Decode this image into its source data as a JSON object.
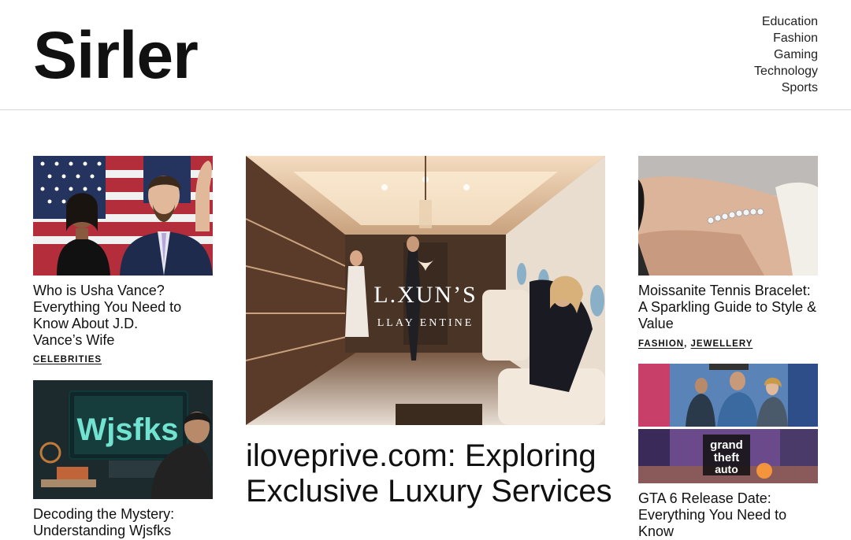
{
  "site": {
    "logo": "Sirler"
  },
  "nav": [
    "Education",
    "Fashion",
    "Gaming",
    "Technology",
    "Sports"
  ],
  "left_col": [
    {
      "title": "Who is Usha Vance? Everything You Need to Know About J.D. Vance’s Wife",
      "category": "CELEBRITIES"
    },
    {
      "title": "Decoding the Mystery: Understanding Wjsfks",
      "image_text": "Wjsfks"
    }
  ],
  "featured": {
    "title": "iloveprive.com: Exploring Exclusive Luxury Services",
    "image_text_1": "L.XUN’S",
    "image_text_2": "LLAY ENTINE"
  },
  "right_col": [
    {
      "title": "Moissanite Tennis Bracelet: A Sparkling Guide to Style & Value",
      "categories": [
        "FASHION",
        "JEWELLERY"
      ],
      "category_separator": ","
    },
    {
      "title": "GTA 6 Release Date: Everything You Need to Know",
      "image_text_1": "grand",
      "image_text_2": "theft",
      "image_text_3": "auto"
    }
  ]
}
